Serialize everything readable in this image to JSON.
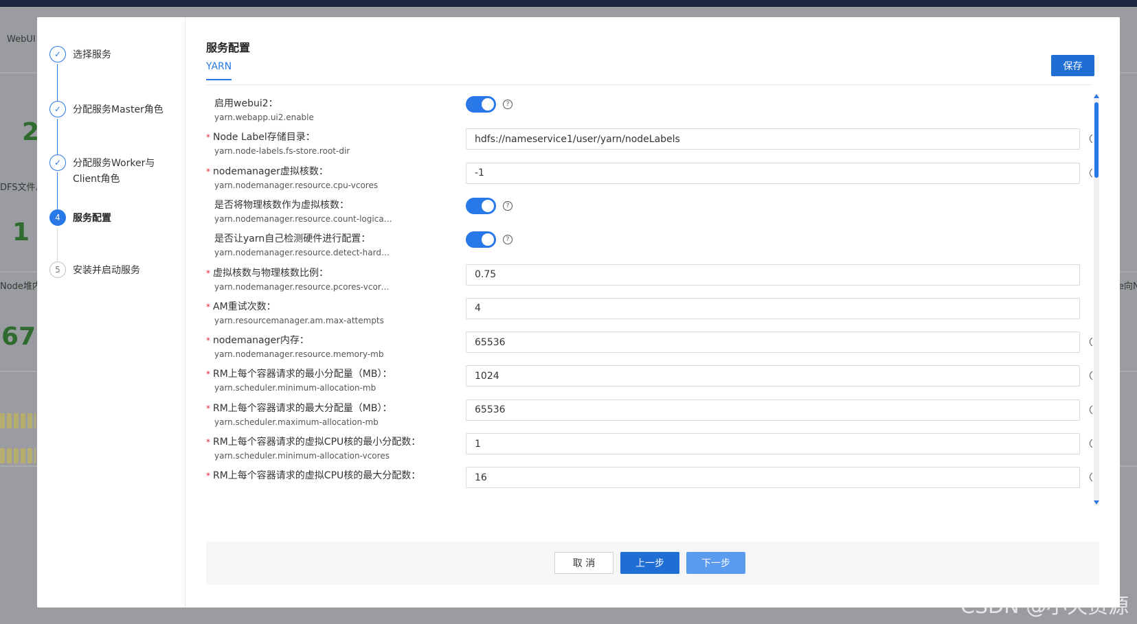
{
  "background": {
    "tab_fragment": "WebUI",
    "labels": [
      "DFS文件总",
      "Node堆内",
      "e向N"
    ],
    "numbers": [
      "2",
      "1",
      "67"
    ]
  },
  "steps": [
    {
      "label": "选择服务",
      "state": "done",
      "number": ""
    },
    {
      "label": "分配服务Master角色",
      "state": "done",
      "number": ""
    },
    {
      "label": "分配服务Worker与Client角色",
      "state": "done",
      "number": ""
    },
    {
      "label": "服务配置",
      "state": "active",
      "number": "4"
    },
    {
      "label": "安装并启动服务",
      "state": "todo",
      "number": "5"
    }
  ],
  "header": {
    "title": "服务配置",
    "tab": "YARN",
    "save_label": "保存"
  },
  "form": {
    "fields": [
      {
        "label": "启用webui2：",
        "key": "yarn.webapp.ui2.enable",
        "required": false,
        "type": "toggle",
        "value": "on"
      },
      {
        "label": "Node Label存储目录：",
        "key": "yarn.node-labels.fs-store.root-dir",
        "required": true,
        "type": "input",
        "value": "hdfs://nameservice1/user/yarn/nodeLabels"
      },
      {
        "label": "nodemanager虚拟核数：",
        "key": "yarn.nodemanager.resource.cpu-vcores",
        "required": true,
        "type": "input",
        "value": "-1"
      },
      {
        "label": "是否将物理核数作为虚拟核数：",
        "key": "yarn.nodemanager.resource.count-logical-pr···",
        "required": false,
        "type": "toggle",
        "value": "on"
      },
      {
        "label": "是否让yarn自己检测硬件进行配置：",
        "key": "yarn.nodemanager.resource.detect-hardwar···",
        "required": false,
        "type": "toggle",
        "value": "on"
      },
      {
        "label": "虚拟核数与物理核数比例：",
        "key": "yarn.nodemanager.resource.pcores-vcores-···",
        "required": true,
        "type": "input",
        "value": "0.75"
      },
      {
        "label": "AM重试次数：",
        "key": "yarn.resourcemanager.am.max-attempts",
        "required": true,
        "type": "input",
        "value": "4"
      },
      {
        "label": "nodemanager内存：",
        "key": "yarn.nodemanager.resource.memory-mb",
        "required": true,
        "type": "input",
        "value": "65536"
      },
      {
        "label": "RM上每个容器请求的最小分配量（MB）：",
        "key": "yarn.scheduler.minimum-allocation-mb",
        "required": true,
        "type": "input",
        "value": "1024"
      },
      {
        "label": "RM上每个容器请求的最大分配量（MB）：",
        "key": "yarn.scheduler.maximum-allocation-mb",
        "required": true,
        "type": "input",
        "value": "65536"
      },
      {
        "label": "RM上每个容器请求的虚拟CPU核的最小分配数：",
        "key": "yarn.scheduler.minimum-allocation-vcores",
        "required": true,
        "type": "input",
        "value": "1"
      },
      {
        "label": "RM上每个容器请求的虚拟CPU核的最大分配数：",
        "key": "",
        "required": true,
        "type": "input",
        "value": "16"
      }
    ],
    "help_icon": "question-circle-icon",
    "help_glyph": "?"
  },
  "footer": {
    "cancel_label": "取 消",
    "prev_label": "上一步",
    "next_label": "下一步"
  },
  "watermark": "CSDN @小天资源",
  "colors": {
    "primary": "#1f6ed4",
    "accent": "#2878e8",
    "required": "#e0272f"
  }
}
